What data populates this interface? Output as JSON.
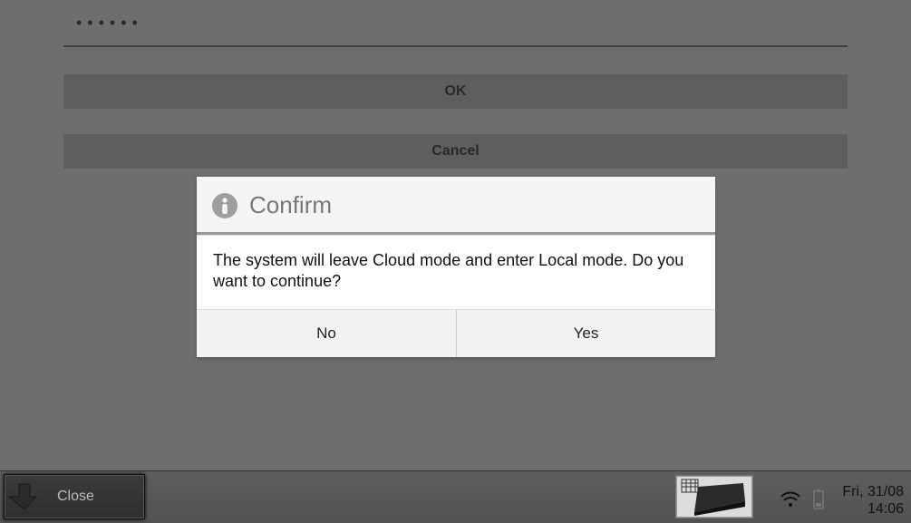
{
  "form": {
    "password_mask": "••••••",
    "ok_label": "OK",
    "cancel_label": "Cancel"
  },
  "dialog": {
    "title": "Confirm",
    "message": "The system will leave Cloud mode and enter Local mode. Do you want to continue?",
    "no_label": "No",
    "yes_label": "Yes"
  },
  "bottombar": {
    "close_label": "Close",
    "date_line": "Fri, 31/08",
    "time_line": "14:06"
  }
}
